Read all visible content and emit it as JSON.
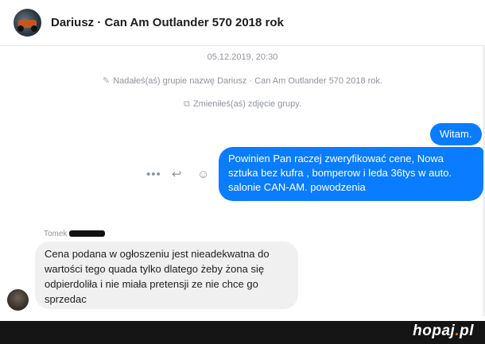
{
  "header": {
    "title": "Dariusz · Can Am Outlander 570 2018 rok",
    "avatar_icon": "group-avatar-atv"
  },
  "conversation": {
    "timestamp": "05.12.2019, 20:30",
    "system_messages": [
      {
        "icon": "pencil-icon",
        "text": "Nadałeś(aś) grupie nazwę Dariusz · Can Am Outlander 570 2018 rok."
      },
      {
        "icon": "image-icon",
        "text": "Zmieniłeś(aś) zdjęcie grupy."
      }
    ],
    "outgoing": [
      {
        "text": "Witam."
      },
      {
        "lines": [
          "Powinien Pan raczej zweryfikować cene, Nowa",
          "sztuka bez kufra , bomperow i ledа 36tys w auto.",
          "salonie CAN-AM. powodzenia"
        ]
      }
    ],
    "actions": {
      "more": "•••",
      "reply": "↩",
      "emoji": "☺"
    },
    "incoming": {
      "sender": "Tomek",
      "lines": [
        "Cena podana w ogłoszeniu jest nieadekwatna do",
        "wartości tego quada tylko dlatego żeby żona się",
        "odpierdoliła i nie miała pretensji ze nie chce go",
        "sprzedac"
      ]
    }
  },
  "watermark": {
    "brand": "hopaj",
    "dot": ".",
    "tld": "pl"
  },
  "colors": {
    "outgoing_bubble": "#0a7cff",
    "incoming_bubble": "#f1f0f0",
    "meta_text": "#90949c"
  }
}
